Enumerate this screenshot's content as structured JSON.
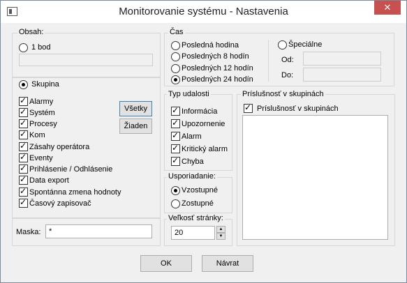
{
  "window": {
    "title": "Monitorovanie systému - Nastavenia",
    "close_glyph": "✕"
  },
  "obsah": {
    "label": "Obsah:",
    "one_point": {
      "label": "1 bod",
      "selected": false
    },
    "group": {
      "label": "Skupina",
      "selected": true
    },
    "items": [
      {
        "label": "Alarmy",
        "checked": true
      },
      {
        "label": "Systém",
        "checked": true
      },
      {
        "label": "Procesy",
        "checked": true
      },
      {
        "label": "Kom",
        "checked": true
      },
      {
        "label": "Zásahy operátora",
        "checked": true
      },
      {
        "label": "Eventy",
        "checked": true
      },
      {
        "label": "Prihlásenie / Odhlásenie",
        "checked": true
      },
      {
        "label": "Data export",
        "checked": true
      },
      {
        "label": "Spontánna zmena hodnoty",
        "checked": true
      },
      {
        "label": "Časový zapisovač",
        "checked": true
      }
    ],
    "all_button": "Všetky",
    "none_button": "Žiaden",
    "mask_label": "Maska:",
    "mask_value": "*"
  },
  "cas": {
    "label": "Čas",
    "options": [
      {
        "label": "Posledná hodina",
        "selected": false
      },
      {
        "label": "Posledných 8 hodín",
        "selected": false
      },
      {
        "label": "Posledných 12 hodín",
        "selected": false
      },
      {
        "label": "Posledných 24 hodín",
        "selected": true
      }
    ],
    "special": {
      "label": "Špeciálne",
      "selected": false
    },
    "from_label": "Od:",
    "to_label": "Do:"
  },
  "typ": {
    "label": "Typ udalosti",
    "items": [
      {
        "label": "Informácia",
        "checked": true
      },
      {
        "label": "Upozornenie",
        "checked": true
      },
      {
        "label": "Alarm",
        "checked": true
      },
      {
        "label": "Kritický alarm",
        "checked": true
      },
      {
        "label": "Chyba",
        "checked": true
      }
    ]
  },
  "sort": {
    "label": "Usporiadanie:",
    "asc": {
      "label": "Vzostupné",
      "selected": true
    },
    "desc": {
      "label": "Zostupné",
      "selected": false
    }
  },
  "page": {
    "label": "Veľkosť stránky:",
    "value": "20"
  },
  "membership": {
    "label": "Príslušnosť v skupinách",
    "checkbox_label": "Príslušnosť v skupinách",
    "checked": true
  },
  "footer": {
    "ok": "OK",
    "back": "Návrat"
  }
}
